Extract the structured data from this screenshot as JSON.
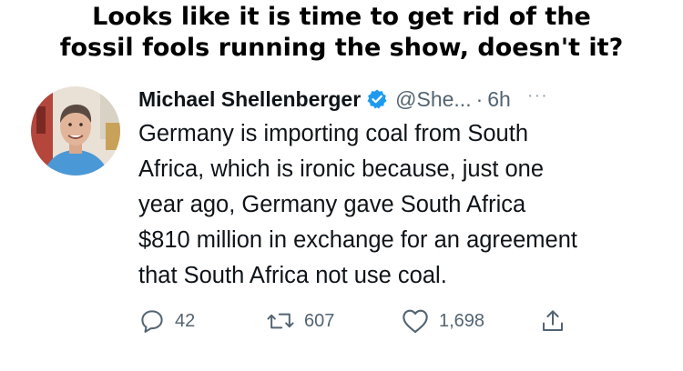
{
  "caption": {
    "line1": "Looks like it is time to get rid of the",
    "line2": "fossil fools running the show, doesn't it?"
  },
  "tweet": {
    "author_name": "Michael Shellenberger",
    "handle": "@She...",
    "separator": "·",
    "time": "6h",
    "more": "···",
    "body_lines": [
      "Germany is importing coal from South",
      "Africa, which is ironic because, just one",
      "year ago, Germany gave South Africa",
      "$810 million in exchange for an agreement",
      "that South Africa not use coal."
    ],
    "replies": "42",
    "retweets": "607",
    "likes": "1,698",
    "icons": {
      "reply": "reply-icon",
      "retweet": "retweet-icon",
      "like": "heart-icon",
      "share": "share-icon",
      "verified": "verified-badge-icon"
    }
  },
  "colors": {
    "text": "#0f1419",
    "secondary": "#536471",
    "verified": "#1d9bf0"
  }
}
